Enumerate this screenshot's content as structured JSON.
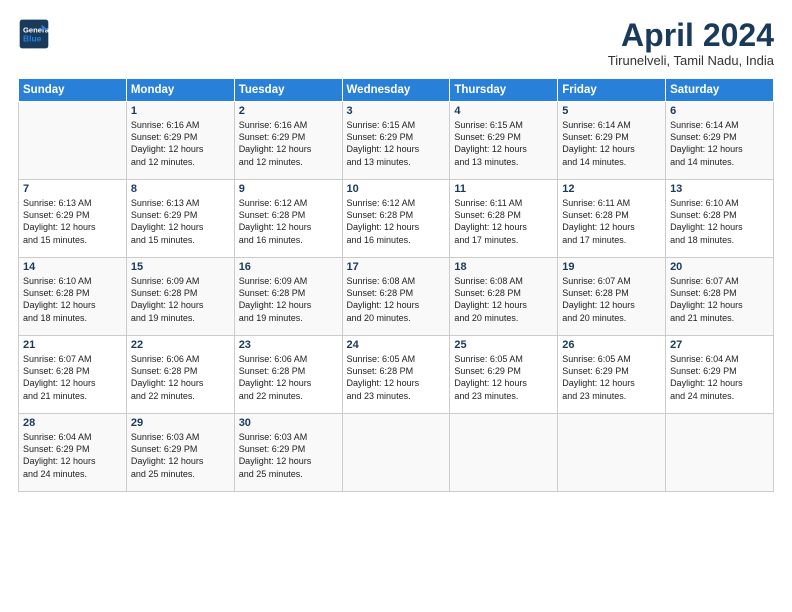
{
  "header": {
    "logo_line1": "General",
    "logo_line2": "Blue",
    "month": "April 2024",
    "location": "Tirunelveli, Tamil Nadu, India"
  },
  "weekdays": [
    "Sunday",
    "Monday",
    "Tuesday",
    "Wednesday",
    "Thursday",
    "Friday",
    "Saturday"
  ],
  "weeks": [
    [
      {
        "day": "",
        "info": ""
      },
      {
        "day": "1",
        "info": "Sunrise: 6:16 AM\nSunset: 6:29 PM\nDaylight: 12 hours\nand 12 minutes."
      },
      {
        "day": "2",
        "info": "Sunrise: 6:16 AM\nSunset: 6:29 PM\nDaylight: 12 hours\nand 12 minutes."
      },
      {
        "day": "3",
        "info": "Sunrise: 6:15 AM\nSunset: 6:29 PM\nDaylight: 12 hours\nand 13 minutes."
      },
      {
        "day": "4",
        "info": "Sunrise: 6:15 AM\nSunset: 6:29 PM\nDaylight: 12 hours\nand 13 minutes."
      },
      {
        "day": "5",
        "info": "Sunrise: 6:14 AM\nSunset: 6:29 PM\nDaylight: 12 hours\nand 14 minutes."
      },
      {
        "day": "6",
        "info": "Sunrise: 6:14 AM\nSunset: 6:29 PM\nDaylight: 12 hours\nand 14 minutes."
      }
    ],
    [
      {
        "day": "7",
        "info": "Sunrise: 6:13 AM\nSunset: 6:29 PM\nDaylight: 12 hours\nand 15 minutes."
      },
      {
        "day": "8",
        "info": "Sunrise: 6:13 AM\nSunset: 6:29 PM\nDaylight: 12 hours\nand 15 minutes."
      },
      {
        "day": "9",
        "info": "Sunrise: 6:12 AM\nSunset: 6:28 PM\nDaylight: 12 hours\nand 16 minutes."
      },
      {
        "day": "10",
        "info": "Sunrise: 6:12 AM\nSunset: 6:28 PM\nDaylight: 12 hours\nand 16 minutes."
      },
      {
        "day": "11",
        "info": "Sunrise: 6:11 AM\nSunset: 6:28 PM\nDaylight: 12 hours\nand 17 minutes."
      },
      {
        "day": "12",
        "info": "Sunrise: 6:11 AM\nSunset: 6:28 PM\nDaylight: 12 hours\nand 17 minutes."
      },
      {
        "day": "13",
        "info": "Sunrise: 6:10 AM\nSunset: 6:28 PM\nDaylight: 12 hours\nand 18 minutes."
      }
    ],
    [
      {
        "day": "14",
        "info": "Sunrise: 6:10 AM\nSunset: 6:28 PM\nDaylight: 12 hours\nand 18 minutes."
      },
      {
        "day": "15",
        "info": "Sunrise: 6:09 AM\nSunset: 6:28 PM\nDaylight: 12 hours\nand 19 minutes."
      },
      {
        "day": "16",
        "info": "Sunrise: 6:09 AM\nSunset: 6:28 PM\nDaylight: 12 hours\nand 19 minutes."
      },
      {
        "day": "17",
        "info": "Sunrise: 6:08 AM\nSunset: 6:28 PM\nDaylight: 12 hours\nand 20 minutes."
      },
      {
        "day": "18",
        "info": "Sunrise: 6:08 AM\nSunset: 6:28 PM\nDaylight: 12 hours\nand 20 minutes."
      },
      {
        "day": "19",
        "info": "Sunrise: 6:07 AM\nSunset: 6:28 PM\nDaylight: 12 hours\nand 20 minutes."
      },
      {
        "day": "20",
        "info": "Sunrise: 6:07 AM\nSunset: 6:28 PM\nDaylight: 12 hours\nand 21 minutes."
      }
    ],
    [
      {
        "day": "21",
        "info": "Sunrise: 6:07 AM\nSunset: 6:28 PM\nDaylight: 12 hours\nand 21 minutes."
      },
      {
        "day": "22",
        "info": "Sunrise: 6:06 AM\nSunset: 6:28 PM\nDaylight: 12 hours\nand 22 minutes."
      },
      {
        "day": "23",
        "info": "Sunrise: 6:06 AM\nSunset: 6:28 PM\nDaylight: 12 hours\nand 22 minutes."
      },
      {
        "day": "24",
        "info": "Sunrise: 6:05 AM\nSunset: 6:28 PM\nDaylight: 12 hours\nand 23 minutes."
      },
      {
        "day": "25",
        "info": "Sunrise: 6:05 AM\nSunset: 6:29 PM\nDaylight: 12 hours\nand 23 minutes."
      },
      {
        "day": "26",
        "info": "Sunrise: 6:05 AM\nSunset: 6:29 PM\nDaylight: 12 hours\nand 23 minutes."
      },
      {
        "day": "27",
        "info": "Sunrise: 6:04 AM\nSunset: 6:29 PM\nDaylight: 12 hours\nand 24 minutes."
      }
    ],
    [
      {
        "day": "28",
        "info": "Sunrise: 6:04 AM\nSunset: 6:29 PM\nDaylight: 12 hours\nand 24 minutes."
      },
      {
        "day": "29",
        "info": "Sunrise: 6:03 AM\nSunset: 6:29 PM\nDaylight: 12 hours\nand 25 minutes."
      },
      {
        "day": "30",
        "info": "Sunrise: 6:03 AM\nSunset: 6:29 PM\nDaylight: 12 hours\nand 25 minutes."
      },
      {
        "day": "",
        "info": ""
      },
      {
        "day": "",
        "info": ""
      },
      {
        "day": "",
        "info": ""
      },
      {
        "day": "",
        "info": ""
      }
    ]
  ]
}
